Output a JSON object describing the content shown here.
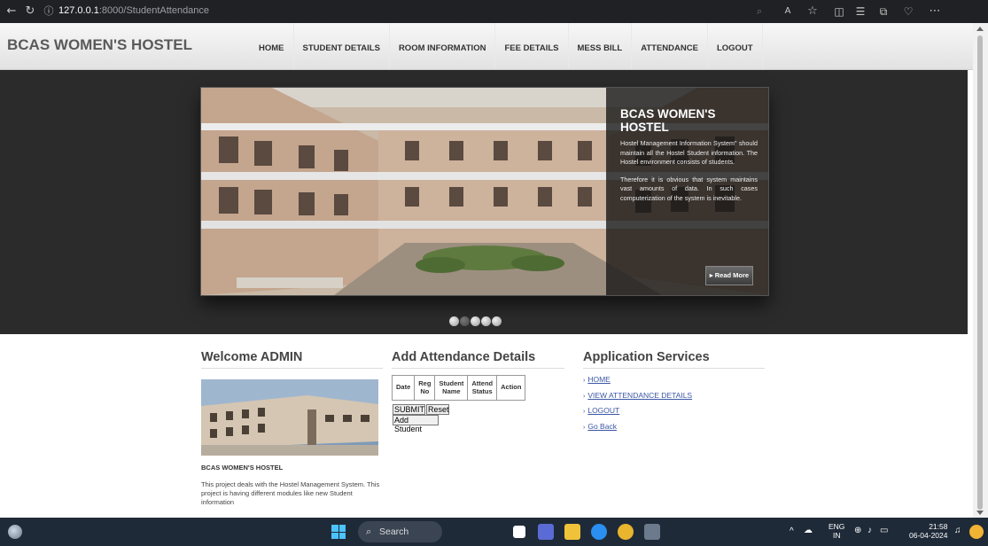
{
  "browser": {
    "url_host": "127.0.0.1",
    "url_path": ":8000/StudentAttendance"
  },
  "header": {
    "brand": "BCAS WOMEN'S HOSTEL",
    "nav": [
      "HOME",
      "STUDENT DETAILS",
      "ROOM INFORMATION",
      "FEE DETAILS",
      "MESS BILL",
      "ATTENDANCE",
      "LOGOUT"
    ]
  },
  "slider": {
    "title": "BCAS WOMEN'S HOSTEL",
    "paragraph1": "Hostel Management Information System\" should maintain all the Hostel Student information. The Hostel environment consists of students.",
    "paragraph2": "Therefore it is obvious that system maintains vast amounts of data. In such cases computerization of the system is inevitable.",
    "read_more": "Read More",
    "dot_count": 5,
    "active_dot": 2
  },
  "welcome": {
    "title": "Welcome ADMIN",
    "caption": "BCAS WOMEN'S HOSTEL",
    "text": "This project deals with the Hostel Management System. This project is having different modules like new Student information"
  },
  "attendance": {
    "title": "Add Attendance Details",
    "columns": [
      "Date",
      "Reg No",
      "Student Name",
      "Attend Status",
      "Action"
    ],
    "submit": "SUBMIT",
    "reset": "Reset",
    "add_student": "Add Student"
  },
  "services": {
    "title": "Application Services",
    "links": [
      "HOME",
      "VIEW ATTENDANCE DETAILS",
      "LOGOUT",
      "Go Back"
    ]
  },
  "taskbar": {
    "search": "Search",
    "lang1": "ENG",
    "lang2": "IN",
    "time": "21:58",
    "date": "06-04-2024"
  }
}
